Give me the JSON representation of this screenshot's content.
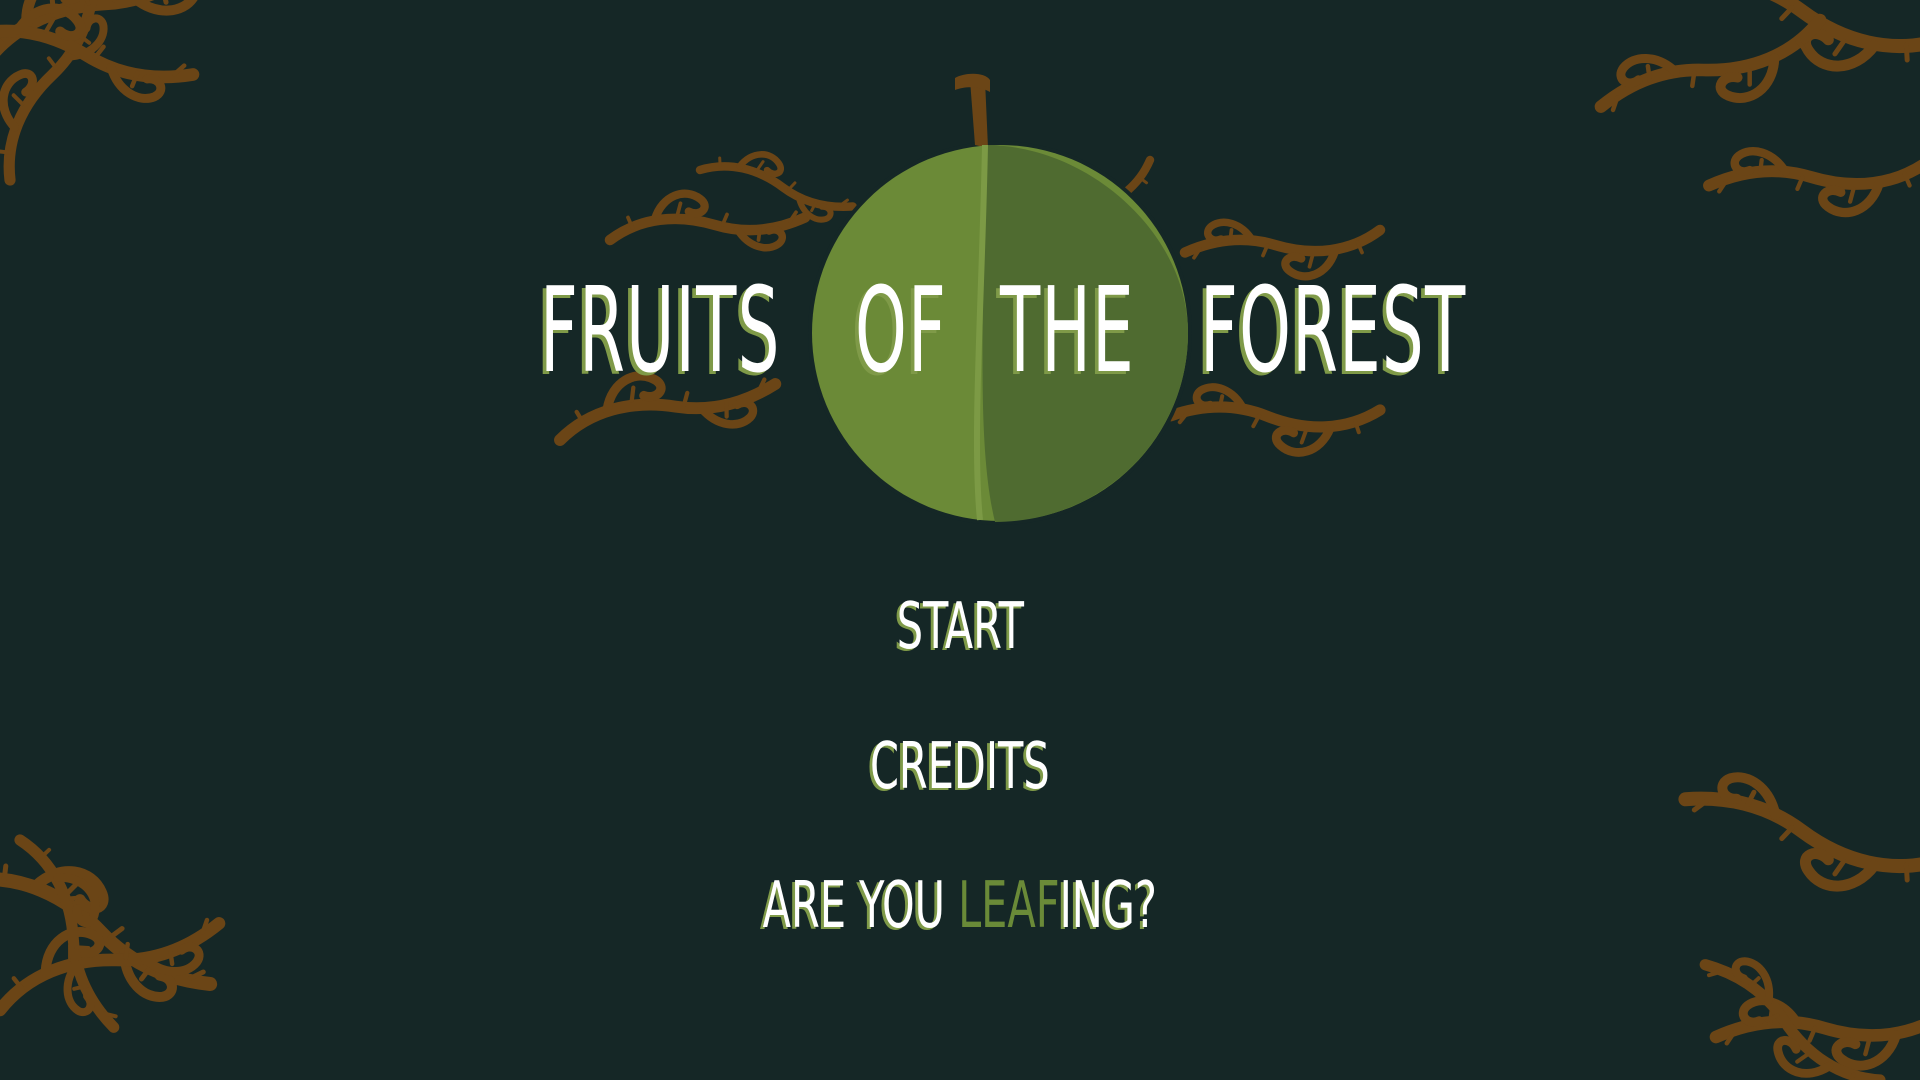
{
  "game": {
    "title_words": [
      "FRUITS",
      "OF",
      "THE",
      "FOREST"
    ]
  },
  "menu": {
    "start_label": "START",
    "credits_label": "CREDITS",
    "quit_prefix": "ARE YOU ",
    "quit_highlight": "LEAF",
    "quit_suffix": "ING?"
  },
  "colors": {
    "background": "#152726",
    "fruit_light": "#6b8a37",
    "fruit_dark": "#4f6b30",
    "stem": "#6b4516",
    "vines": "#6b4516",
    "text": "#ffffff",
    "text_shadow": "#7f9a48"
  },
  "icons": {
    "logo_fruit": "round-green-fruit-icon",
    "decoration": "thorny-vine-icon"
  }
}
